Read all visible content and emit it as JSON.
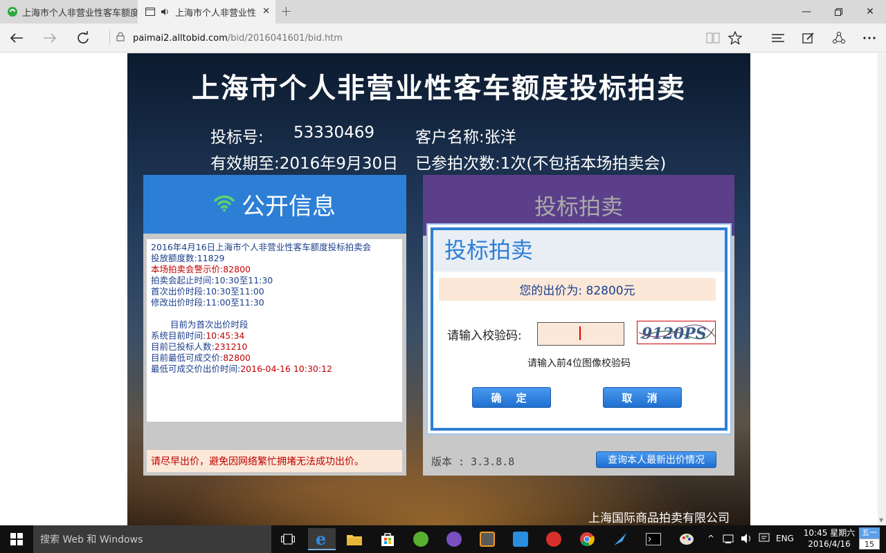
{
  "browser": {
    "tabs": [
      {
        "title": "上海市个人非营业性客车额度",
        "active": false
      },
      {
        "title": "上海市个人非营业性",
        "active": true
      }
    ],
    "url_host": "paimai2.alltobid.com",
    "url_path": "/bid/2016041601/bid.htm"
  },
  "page": {
    "title": "上海市个人非营业性客车额度投标拍卖",
    "bid_number_label": "投标号:",
    "bid_number": "53330469",
    "customer_label": "客户名称:张洋",
    "valid_until": "有效期至:2016年9月30日",
    "attended": "已参拍次数:1次(不包括本场拍卖会)",
    "left_panel": {
      "title": "公开信息",
      "lines": [
        {
          "text": "2016年4月16日上海市个人非营业性客车额度投标拍卖会",
          "color": "#1a3e8c"
        },
        {
          "text": "投放额度数:11829",
          "color": "#1a3e8c"
        },
        {
          "text": "本场拍卖会警示价:82800",
          "color": "#c00000"
        },
        {
          "text": "拍卖会起止时间:10:30至11:30",
          "color": "#1a3e8c"
        },
        {
          "text": "首次出价时段:10:30至11:00",
          "color": "#1a3e8c"
        },
        {
          "text": "修改出价时段:11:00至11:30",
          "color": "#1a3e8c"
        }
      ],
      "phase": "目前为首次出价时段",
      "status": {
        "system_time_label": "系统目前时间:",
        "system_time": "10:45:34",
        "bidders_label": "目前已投标人数:",
        "bidders": "231210",
        "lowest_price_label": "目前最低可成交价:",
        "lowest_price": "82800",
        "lowest_time_label": "最低可成交价出价时间:",
        "lowest_time": "2016-04-16 10:30:12"
      },
      "warning": "请尽早出价，避免因网络繁忙拥堵无法成功出价。"
    },
    "right_panel": {
      "title": "投标拍卖",
      "dialog_title": "投标拍卖",
      "price_text": "您的出价为: 82800元",
      "captcha_label": "请输入校验码:",
      "captcha_value": "",
      "captcha_image_text": "9120PS",
      "captcha_hint": "请输入前4位图像校验码",
      "confirm": "确 定",
      "cancel": "取 消",
      "version": "版本 : 3.3.8.8",
      "query": "查询本人最新出价情况"
    },
    "company": "上海国际商品拍卖有限公司"
  },
  "taskbar": {
    "search_placeholder": "搜索 Web 和 Windows",
    "lang": "ENG",
    "time": "10:45 星期六",
    "date": "2016/4/16",
    "cal_weekday": "五一",
    "cal_day": "15"
  },
  "colors": {
    "accent_blue": "#2d7fd6",
    "purple": "#5b3f8a",
    "warning_red": "#c00000",
    "light_peach": "#fbe8d8"
  }
}
